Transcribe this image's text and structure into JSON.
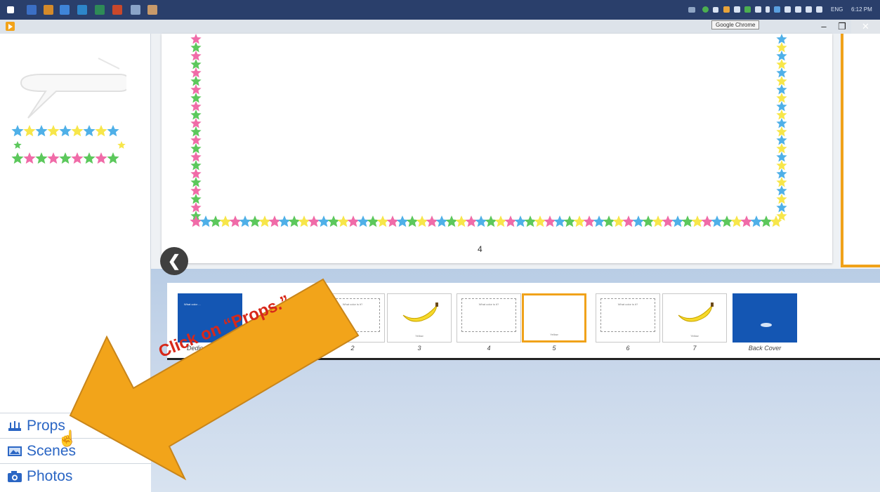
{
  "taskbar": {
    "icons": [
      "start-icon",
      "app-icon",
      "app-icon",
      "ie-icon",
      "app-icon",
      "excel-icon",
      "ppt-icon",
      "app-icon",
      "app-icon"
    ],
    "tray_lang": "ENG",
    "tray_time": "6:12 PM"
  },
  "window": {
    "tooltip": "Google Chrome",
    "minimize": "–",
    "maximize": "❐",
    "close": "✕"
  },
  "nav": {
    "props": "Props",
    "scenes": "Scenes",
    "photos": "Photos"
  },
  "canvas": {
    "page_number": "4"
  },
  "filmstrip": {
    "thumbs": [
      {
        "label": "Dedication Page",
        "type": "blue",
        "text": "What color ..."
      },
      {
        "label": "2",
        "type": "text",
        "text": "What color is it?"
      },
      {
        "label": "3",
        "type": "banana",
        "text": "Yellow"
      },
      {
        "label": "4",
        "type": "text",
        "text": "What color is it?"
      },
      {
        "label": "5",
        "type": "selected",
        "text": "Yellow"
      },
      {
        "label": "6",
        "type": "text",
        "text": "What color is it?"
      },
      {
        "label": "7",
        "type": "banana",
        "text": "Yellow"
      },
      {
        "label": "Back Cover",
        "type": "blue",
        "text": ""
      }
    ]
  },
  "annotation": {
    "callout": "Click on “Props.”",
    "arrow_color": "#f2a41a",
    "text_color": "#d7281a"
  },
  "colors": {
    "taskbar": "#2a3f6b",
    "accent_orange": "#f0a21a",
    "nav_blue": "#2b66c4",
    "cover_blue": "#1456b3"
  }
}
